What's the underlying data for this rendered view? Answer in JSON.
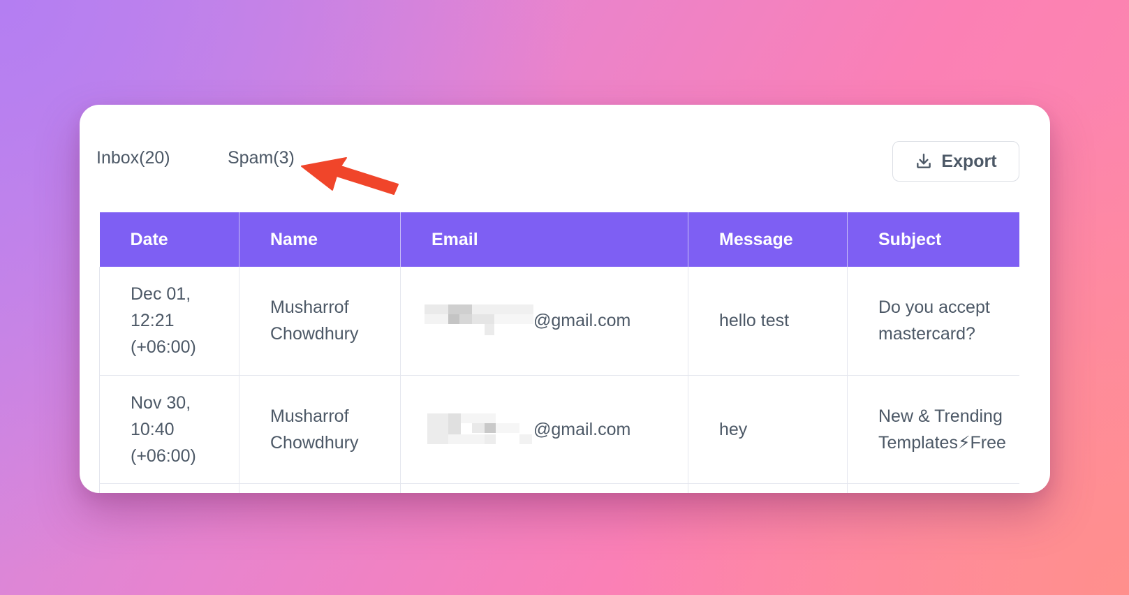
{
  "tabs": [
    {
      "label": "Inbox(20)"
    },
    {
      "label": "Spam(3)"
    }
  ],
  "toolbar": {
    "export_label": "Export"
  },
  "table": {
    "columns": [
      "Date",
      "Name",
      "Email",
      "Message",
      "Subject"
    ],
    "rows": [
      {
        "date_line1": "Dec 01,",
        "date_line2": "12:21",
        "date_line3": "(+06:00)",
        "name_line1": "Musharrof",
        "name_line2": "Chowdhury",
        "email_domain": "@gmail.com",
        "message": "hello test",
        "subject_line1": "Do you accept",
        "subject_line2": "mastercard?"
      },
      {
        "date_line1": "Nov 30,",
        "date_line2": "10:40",
        "date_line3": "(+06:00)",
        "name_line1": "Musharrof",
        "name_line2": "Chowdhury",
        "email_domain": "@gmail.com",
        "message": "hey",
        "subject_line1": "New & Trending",
        "subject_line2": "Templates⚡Free"
      }
    ]
  },
  "colors": {
    "header_bg": "#7e5ff3",
    "arrow": "#f0452a"
  },
  "icons": {
    "export": "download-icon",
    "annotation": "red-arrow-icon"
  }
}
